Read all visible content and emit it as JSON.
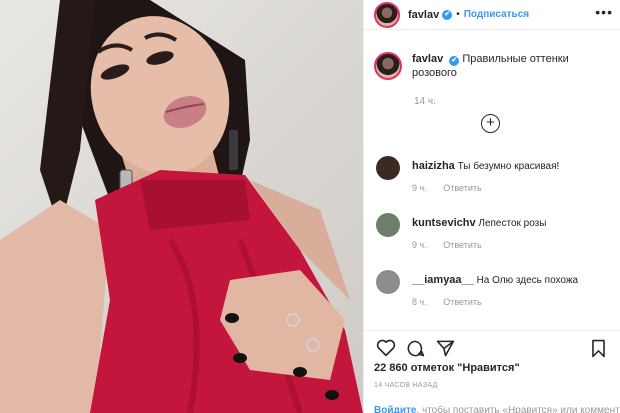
{
  "header": {
    "username": "favlav",
    "verified_mark": "✔",
    "dot": "•",
    "follow_label": "Подписаться",
    "more_label": "•••"
  },
  "caption": {
    "username": "favlav",
    "text": "Правильные оттенки розового",
    "time": "14 ч."
  },
  "load_more_label": "+",
  "comments": [
    {
      "username": "haizizha",
      "text": "Ты безумно красивая!",
      "time": "9 ч.",
      "reply_label": "Ответить",
      "avatar_color": "#3a2a22"
    },
    {
      "username": "kuntsevichv",
      "text": "Лепесток розы",
      "time": "9 ч.",
      "reply_label": "Ответить",
      "avatar_color": "#6d7f6a"
    },
    {
      "username": "__iamyaa__",
      "text": "На Олю здесь похожа",
      "time": "8 ч.",
      "reply_label": "Ответить",
      "avatar_color": "#8c8c8c"
    }
  ],
  "likes_text": "22 860 отметок \"Нравится\"",
  "posted_ago": "14 ЧАСОВ НАЗАД",
  "login_prompt": {
    "link": "Войдите",
    "rest": ", чтобы поставить «Нравится» или комментарий."
  },
  "icons": [
    "heart-icon",
    "comment-icon",
    "share-icon",
    "bookmark-icon",
    "more-icon",
    "verified-icon",
    "plus-circle-icon"
  ],
  "colors": {
    "accent": "#3897f0",
    "dress": "#c4163c",
    "muted": "#999999"
  }
}
